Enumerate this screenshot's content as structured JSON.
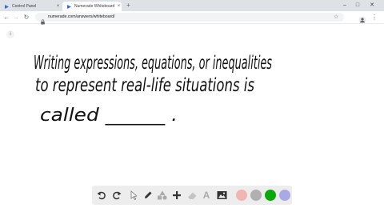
{
  "browser": {
    "tabs": [
      {
        "label": "Control Panel",
        "active": false
      },
      {
        "label": "Numerade Whiteboard",
        "active": true
      }
    ],
    "new_tab_glyph": "+",
    "window_controls": {
      "minimize": "–",
      "maximize": "□",
      "close": "✕"
    },
    "url": "numerade.com/answers/whiteboard/",
    "tab_close_glyph": "×"
  },
  "whiteboard": {
    "handwritten_text": [
      "Writing expressions, equations, or inequalities",
      "to represent real-life situations is",
      "called ______ ."
    ],
    "info_glyph": "i",
    "tools": [
      "undo-icon",
      "redo-icon",
      "select-icon",
      "pen-icon",
      "shapes-icon",
      "add-icon",
      "eraser-icon",
      "text-icon",
      "image-icon"
    ],
    "colors": [
      "#f0b6b4",
      "#b0b0b0",
      "#0aa80a",
      "#a9a9e6"
    ],
    "text_tool_glyph": "A"
  }
}
